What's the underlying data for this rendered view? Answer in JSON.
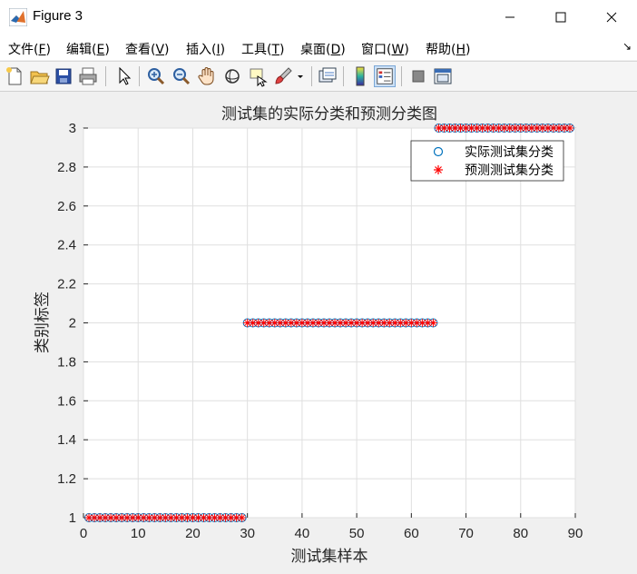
{
  "window": {
    "title": "Figure 3"
  },
  "menu": [
    {
      "label": "文件(",
      "key": "F",
      "end": ")"
    },
    {
      "label": "编辑(",
      "key": "E",
      "end": ")"
    },
    {
      "label": "查看(",
      "key": "V",
      "end": ")"
    },
    {
      "label": "插入(",
      "key": "I",
      "end": ")"
    },
    {
      "label": "工具(",
      "key": "T",
      "end": ")"
    },
    {
      "label": "桌面(",
      "key": "D",
      "end": ")"
    },
    {
      "label": "窗口(",
      "key": "W",
      "end": ")"
    },
    {
      "label": "帮助(",
      "key": "H",
      "end": ")"
    }
  ],
  "toolbar_icons": [
    "new-file-icon",
    "open-file-icon",
    "save-icon",
    "print-icon",
    "pointer-icon",
    "zoom-in-icon",
    "zoom-out-icon",
    "pan-hand-icon",
    "rotate-3d-icon",
    "data-cursor-icon",
    "brush-icon",
    "brush-dropdown-icon",
    "link-plot-icon",
    "colorbar-icon",
    "legend-icon",
    "hide-plot-tools-icon",
    "show-plot-tools-icon"
  ],
  "chart_data": {
    "type": "scatter",
    "title": "测试集的实际分类和预测分类图",
    "xlabel": "测试集样本",
    "ylabel": "类别标签",
    "xlim": [
      0,
      90
    ],
    "ylim": [
      1,
      3
    ],
    "xticks": [
      0,
      10,
      20,
      30,
      40,
      50,
      60,
      70,
      80,
      90
    ],
    "yticks": [
      1,
      1.2,
      1.4,
      1.6,
      1.8,
      2,
      2.2,
      2.4,
      2.6,
      2.8,
      3
    ],
    "grid": true,
    "legend_position": "top-right",
    "series": [
      {
        "name": "实际测试集分类",
        "marker": "circle",
        "color": "#0072bd",
        "segments": [
          {
            "x_from": 1,
            "x_to": 29,
            "y": 1
          },
          {
            "x_from": 30,
            "x_to": 64,
            "y": 2
          },
          {
            "x_from": 65,
            "x_to": 89,
            "y": 3
          }
        ]
      },
      {
        "name": "预测测试集分类",
        "marker": "asterisk",
        "color": "#ff0000",
        "segments": [
          {
            "x_from": 1,
            "x_to": 29,
            "y": 1
          },
          {
            "x_from": 30,
            "x_to": 64,
            "y": 2
          },
          {
            "x_from": 65,
            "x_to": 89,
            "y": 3
          }
        ]
      }
    ]
  }
}
